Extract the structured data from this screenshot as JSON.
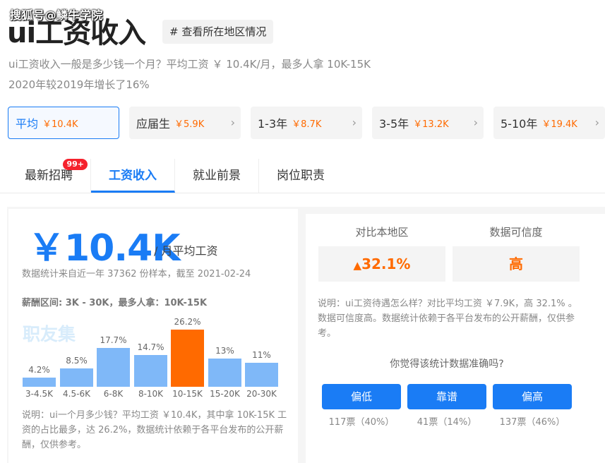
{
  "watermark": "搜狐号@鳞牛学院",
  "header": {
    "title": "ui工资收入",
    "region_button": "# 查看所在地区情况",
    "subtitle_line1": "ui工资收入一般是多少钱一个月？平均工资 ￥ 10.4K/月，最多人拿 10K-15K",
    "subtitle_line2": "2020年较2019年增长了16%"
  },
  "levels": [
    {
      "label": "平均",
      "value": "￥10.4K"
    },
    {
      "label": "应届生",
      "value": "￥5.9K"
    },
    {
      "label": "1-3年",
      "value": "￥8.7K"
    },
    {
      "label": "3-5年",
      "value": "￥13.2K"
    },
    {
      "label": "5-10年",
      "value": "￥19.4K"
    }
  ],
  "tabs": [
    {
      "label": "最新招聘",
      "badge": "99+"
    },
    {
      "label": "工资收入"
    },
    {
      "label": "就业前景"
    },
    {
      "label": "岗位职责"
    }
  ],
  "salary": {
    "amount": "￥10.4K",
    "unit": "/ 月平均工资",
    "stat_note": "数据统计来自近一年 37362 份样本，截至 2021-02-24",
    "range_text": "薪酬区间: 3K - 30K，最多人拿：10K-15K",
    "logo": "职友集",
    "description": "说明：ui一个月多少钱？平均工资 ￥10.4K，其中拿 10K-15K 工资的占比最多，达 26.2%，数据统计依赖于各平台发布的公开薪酬，仅供参考。"
  },
  "chart_data": {
    "type": "bar",
    "categories": [
      "3-4.5K",
      "4.5-6K",
      "6-8K",
      "8-10K",
      "10-15K",
      "15-20K",
      "20-30K"
    ],
    "values": [
      4.2,
      8.5,
      17.7,
      14.7,
      26.2,
      13,
      11
    ],
    "value_labels": [
      "4.2%",
      "8.5%",
      "17.7%",
      "14.7%",
      "26.2%",
      "13%",
      "11%"
    ],
    "highlight_index": 4,
    "colors": {
      "bar": "#7fb8f8",
      "highlight": "#ff6a00"
    }
  },
  "comparison": {
    "local_header": "对比本地区",
    "local_value": "32.1%",
    "confidence_header": "数据可信度",
    "confidence_value": "高",
    "description": "说明：ui工资待遇怎么样？对比平均工资 ￥7.9K，高 32.1% 。数据可信度高。数据统计依赖于各平台发布的公开薪酬，仅供参考。",
    "question": "你觉得该统计数据准确吗?",
    "votes": [
      {
        "label": "偏低",
        "count": "117票（40%）"
      },
      {
        "label": "靠谱",
        "count": "41票（14%）"
      },
      {
        "label": "偏高",
        "count": "137票（46%）"
      }
    ]
  },
  "colors": {
    "accent": "#1a7cf5",
    "orange": "#ff6a00",
    "badge": "#f5222d"
  }
}
